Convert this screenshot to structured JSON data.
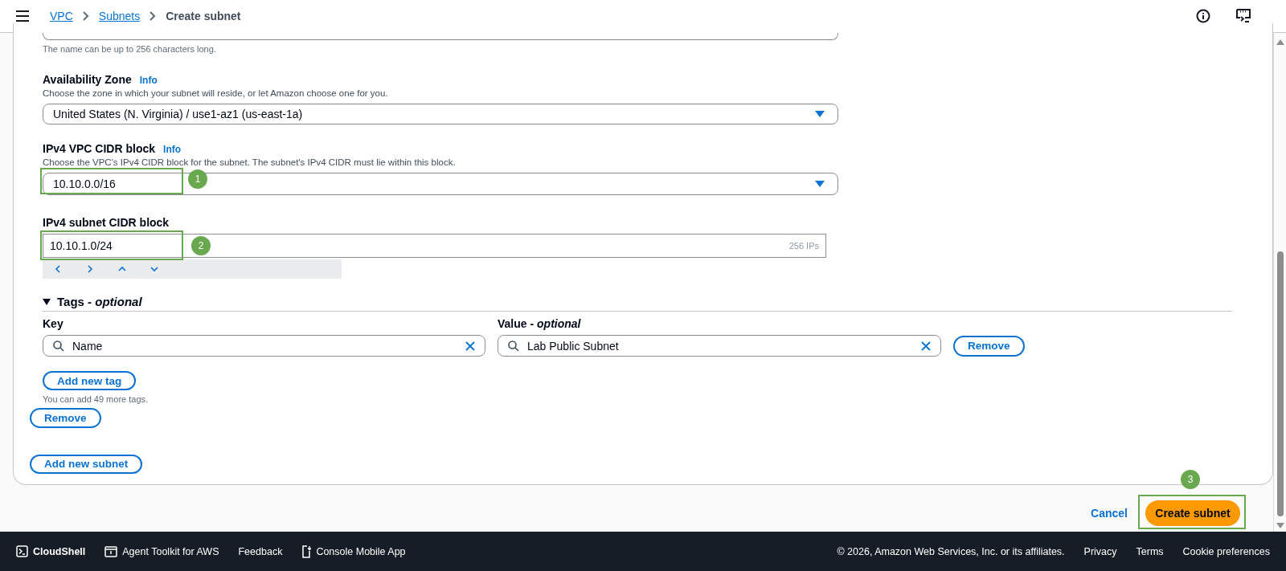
{
  "breadcrumbs": [
    {
      "label": "VPC",
      "link": true
    },
    {
      "label": "Subnets",
      "link": true
    },
    {
      "label": "Create subnet",
      "link": false
    }
  ],
  "name_field": {
    "hint": "The name can be up to 256 characters long."
  },
  "availability_zone": {
    "label": "Availability Zone",
    "info": "Info",
    "description": "Choose the zone in which your subnet will reside, or let Amazon choose one for you.",
    "value": "United States (N. Virginia) / use1-az1 (us-east-1a)"
  },
  "vpc_cidr": {
    "label": "IPv4 VPC CIDR block",
    "info": "Info",
    "description": "Choose the VPC's IPv4 CIDR block for the subnet. The subnet's IPv4 CIDR must lie within this block.",
    "value": "10.10.0.0/16",
    "step": "1"
  },
  "subnet_cidr": {
    "label": "IPv4 subnet CIDR block",
    "value": "10.10.1.0/24",
    "suffix": "256 IPs",
    "step": "2"
  },
  "tags": {
    "title": "Tags - *optional*",
    "expanded": true,
    "key_label": "Key",
    "value_label": "Value - *optional*",
    "rows": [
      {
        "key": "Name",
        "value": "Lab Public Subnet",
        "remove": "Remove"
      }
    ],
    "add_tag": "Add new tag",
    "limit_note": "You can add 49 more tags."
  },
  "remove_subnet": "Remove",
  "add_subnet": "Add new subnet",
  "actions": {
    "cancel": "Cancel",
    "submit": "Create subnet",
    "step": "3"
  },
  "footer": {
    "items": [
      {
        "label": "CloudShell",
        "kind": "terminal"
      },
      {
        "label": "Agent Toolkit for AWS",
        "kind": "window"
      },
      {
        "label": "Feedback",
        "kind": "plain"
      },
      {
        "label": "Console Mobile App",
        "kind": "phone"
      }
    ],
    "copyright": "© 2026, Amazon Web Services, Inc. or its affiliates.",
    "links": [
      "Privacy",
      "Terms",
      "Cookie preferences"
    ]
  }
}
